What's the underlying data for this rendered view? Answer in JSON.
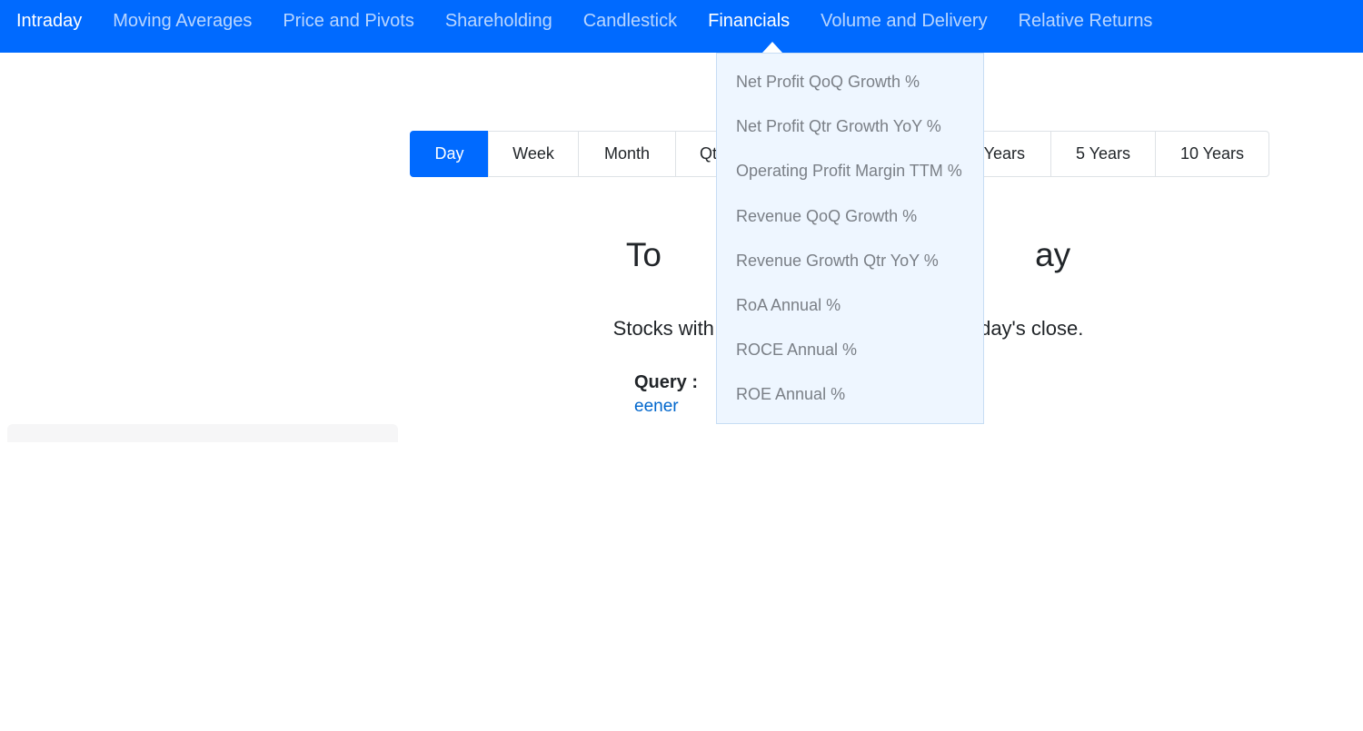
{
  "nav": {
    "items": [
      {
        "label": "Intraday",
        "active": false
      },
      {
        "label": "Moving Averages",
        "active": false
      },
      {
        "label": "Price and Pivots",
        "active": false
      },
      {
        "label": "Shareholding",
        "active": false
      },
      {
        "label": "Candlestick",
        "active": false
      },
      {
        "label": "Financials",
        "active": true
      },
      {
        "label": "Volume and Delivery",
        "active": false
      },
      {
        "label": "Relative Returns",
        "active": false
      }
    ]
  },
  "dropdown": {
    "items": [
      "Net Profit QoQ Growth %",
      "Net Profit Qtr Growth YoY %",
      "Operating Profit Margin TTM %",
      "Revenue QoQ Growth %",
      "Revenue Growth Qtr YoY %",
      "RoA Annual %",
      "ROCE Annual %",
      "ROE Annual %"
    ]
  },
  "periods": {
    "items": [
      "Day",
      "Week",
      "Month",
      "Qtr",
      "3 Years",
      "5 Years",
      "10 Years"
    ],
    "selected": "Day"
  },
  "main": {
    "title": "To                                        ay",
    "description": "Stocks with a                                          s day's close.",
    "query_label": "Query :",
    "query_link": "eener"
  },
  "colors": {
    "navbar": "#006aff",
    "accent": "#006aff",
    "dropdown_bg": "#eef6ff",
    "link": "#0066cc"
  }
}
